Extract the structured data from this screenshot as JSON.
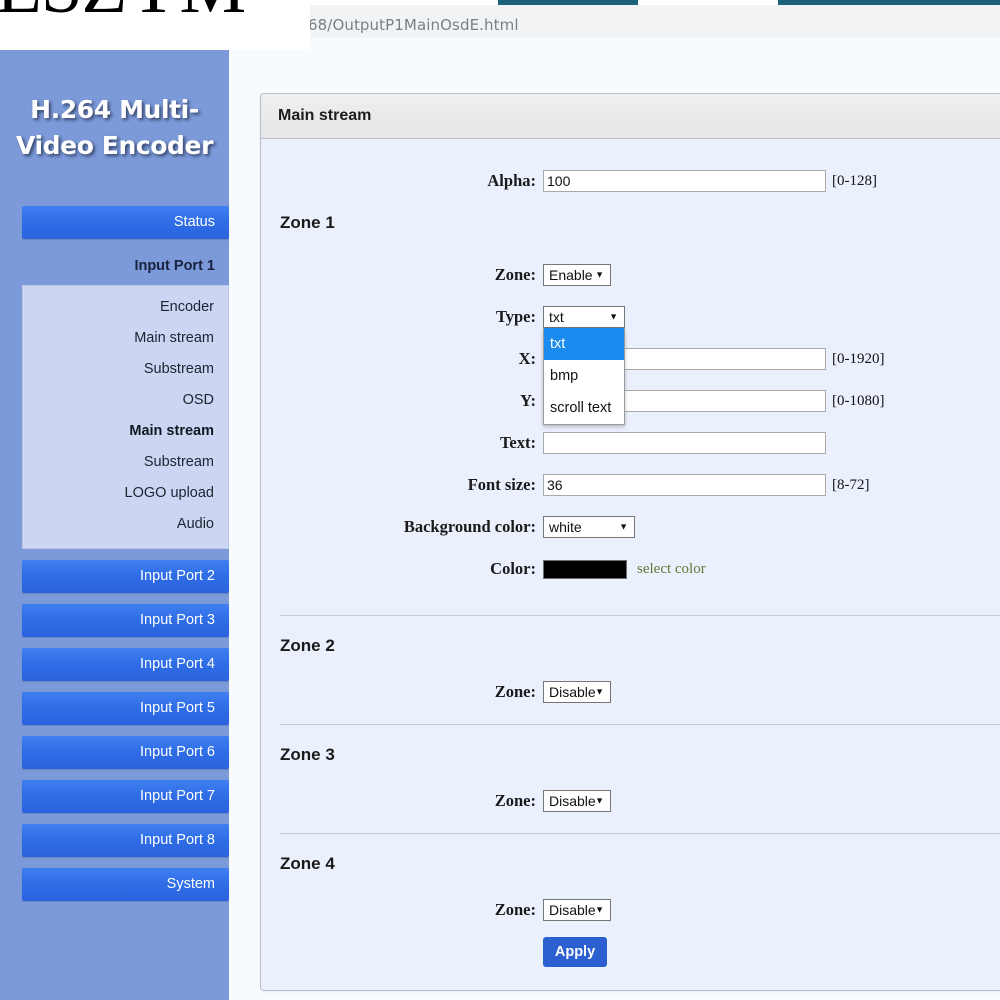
{
  "browser": {
    "url": "68/OutputP1MainOsdE.html"
  },
  "brand": {
    "logo_word": "ESZYM",
    "registered_mark": "®",
    "title_line1": "H.264 Multi-",
    "title_line2": "Video Encoder"
  },
  "sidebar": {
    "status_label": "Status",
    "input_port_1_label": "Input Port 1",
    "submenu": [
      {
        "label": "Encoder",
        "active": false
      },
      {
        "label": "Main stream",
        "active": false
      },
      {
        "label": "Substream",
        "active": false
      },
      {
        "label": "OSD",
        "active": false
      },
      {
        "label": "Main stream",
        "active": true
      },
      {
        "label": "Substream",
        "active": false
      },
      {
        "label": "LOGO upload",
        "active": false
      },
      {
        "label": "Audio",
        "active": false
      }
    ],
    "ports": [
      {
        "label": "Input Port 2"
      },
      {
        "label": "Input Port 3"
      },
      {
        "label": "Input Port 4"
      },
      {
        "label": "Input Port 5"
      },
      {
        "label": "Input Port 6"
      },
      {
        "label": "Input Port 7"
      },
      {
        "label": "Input Port 8"
      }
    ],
    "system_label": "System"
  },
  "panel": {
    "header_title": "Main stream",
    "alpha": {
      "label": "Alpha:",
      "value": "100",
      "hint": "[0-128]"
    },
    "zone1": {
      "title": "Zone 1",
      "zone": {
        "label": "Zone:",
        "value": "Enable"
      },
      "type": {
        "label": "Type:",
        "value": "txt",
        "options": [
          "txt",
          "bmp",
          "scroll text"
        ],
        "open": true
      },
      "x": {
        "label": "X:",
        "value": "",
        "hint": "[0-1920]"
      },
      "y": {
        "label": "Y:",
        "value": "",
        "hint": "[0-1080]"
      },
      "text": {
        "label": "Text:",
        "value": "",
        "hint": ""
      },
      "font_size": {
        "label": "Font size:",
        "value": "36",
        "hint": "[8-72]"
      },
      "background_color": {
        "label": "Background color:",
        "value": "white"
      },
      "color": {
        "label": "Color:",
        "swatch_hex": "#000000",
        "link_label": "select color"
      }
    },
    "zone2": {
      "title": "Zone 2",
      "zone": {
        "label": "Zone:",
        "value": "Disable"
      }
    },
    "zone3": {
      "title": "Zone 3",
      "zone": {
        "label": "Zone:",
        "value": "Disable"
      }
    },
    "zone4": {
      "title": "Zone 4",
      "zone": {
        "label": "Zone:",
        "value": "Disable"
      }
    },
    "apply_label": "Apply"
  },
  "colors": {
    "sidebar_bg": "#7c9ad9",
    "nav_button": "#2f6ee6",
    "panel_bg": "#eaf0fc",
    "dropdown_highlight": "#1a8cf0",
    "apply_button": "#2c5fd0",
    "select_color_link": "#5f7a3a"
  },
  "icons": {
    "caret": "▼"
  }
}
